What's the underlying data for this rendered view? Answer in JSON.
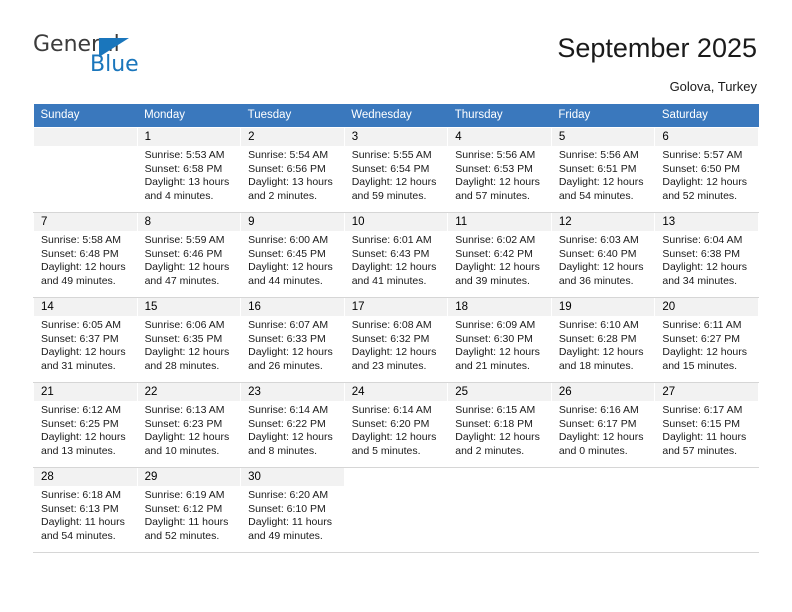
{
  "brand": {
    "name_top": "General",
    "name_bottom": "Blue",
    "triangle_icon": "triangle-icon",
    "accent_color": "#1a76bc"
  },
  "header": {
    "title": "September 2025",
    "subtitle": "Golova, Turkey"
  },
  "calendar": {
    "header_bg": "#3a78bd",
    "daynum_bg": "#f2f2f2",
    "weekdays": [
      "Sunday",
      "Monday",
      "Tuesday",
      "Wednesday",
      "Thursday",
      "Friday",
      "Saturday"
    ],
    "weeks": [
      [
        {
          "day": "",
          "lines": []
        },
        {
          "day": "1",
          "lines": [
            "Sunrise: 5:53 AM",
            "Sunset: 6:58 PM",
            "Daylight: 13 hours",
            "and 4 minutes."
          ]
        },
        {
          "day": "2",
          "lines": [
            "Sunrise: 5:54 AM",
            "Sunset: 6:56 PM",
            "Daylight: 13 hours",
            "and 2 minutes."
          ]
        },
        {
          "day": "3",
          "lines": [
            "Sunrise: 5:55 AM",
            "Sunset: 6:54 PM",
            "Daylight: 12 hours",
            "and 59 minutes."
          ]
        },
        {
          "day": "4",
          "lines": [
            "Sunrise: 5:56 AM",
            "Sunset: 6:53 PM",
            "Daylight: 12 hours",
            "and 57 minutes."
          ]
        },
        {
          "day": "5",
          "lines": [
            "Sunrise: 5:56 AM",
            "Sunset: 6:51 PM",
            "Daylight: 12 hours",
            "and 54 minutes."
          ]
        },
        {
          "day": "6",
          "lines": [
            "Sunrise: 5:57 AM",
            "Sunset: 6:50 PM",
            "Daylight: 12 hours",
            "and 52 minutes."
          ]
        }
      ],
      [
        {
          "day": "7",
          "lines": [
            "Sunrise: 5:58 AM",
            "Sunset: 6:48 PM",
            "Daylight: 12 hours",
            "and 49 minutes."
          ]
        },
        {
          "day": "8",
          "lines": [
            "Sunrise: 5:59 AM",
            "Sunset: 6:46 PM",
            "Daylight: 12 hours",
            "and 47 minutes."
          ]
        },
        {
          "day": "9",
          "lines": [
            "Sunrise: 6:00 AM",
            "Sunset: 6:45 PM",
            "Daylight: 12 hours",
            "and 44 minutes."
          ]
        },
        {
          "day": "10",
          "lines": [
            "Sunrise: 6:01 AM",
            "Sunset: 6:43 PM",
            "Daylight: 12 hours",
            "and 41 minutes."
          ]
        },
        {
          "day": "11",
          "lines": [
            "Sunrise: 6:02 AM",
            "Sunset: 6:42 PM",
            "Daylight: 12 hours",
            "and 39 minutes."
          ]
        },
        {
          "day": "12",
          "lines": [
            "Sunrise: 6:03 AM",
            "Sunset: 6:40 PM",
            "Daylight: 12 hours",
            "and 36 minutes."
          ]
        },
        {
          "day": "13",
          "lines": [
            "Sunrise: 6:04 AM",
            "Sunset: 6:38 PM",
            "Daylight: 12 hours",
            "and 34 minutes."
          ]
        }
      ],
      [
        {
          "day": "14",
          "lines": [
            "Sunrise: 6:05 AM",
            "Sunset: 6:37 PM",
            "Daylight: 12 hours",
            "and 31 minutes."
          ]
        },
        {
          "day": "15",
          "lines": [
            "Sunrise: 6:06 AM",
            "Sunset: 6:35 PM",
            "Daylight: 12 hours",
            "and 28 minutes."
          ]
        },
        {
          "day": "16",
          "lines": [
            "Sunrise: 6:07 AM",
            "Sunset: 6:33 PM",
            "Daylight: 12 hours",
            "and 26 minutes."
          ]
        },
        {
          "day": "17",
          "lines": [
            "Sunrise: 6:08 AM",
            "Sunset: 6:32 PM",
            "Daylight: 12 hours",
            "and 23 minutes."
          ]
        },
        {
          "day": "18",
          "lines": [
            "Sunrise: 6:09 AM",
            "Sunset: 6:30 PM",
            "Daylight: 12 hours",
            "and 21 minutes."
          ]
        },
        {
          "day": "19",
          "lines": [
            "Sunrise: 6:10 AM",
            "Sunset: 6:28 PM",
            "Daylight: 12 hours",
            "and 18 minutes."
          ]
        },
        {
          "day": "20",
          "lines": [
            "Sunrise: 6:11 AM",
            "Sunset: 6:27 PM",
            "Daylight: 12 hours",
            "and 15 minutes."
          ]
        }
      ],
      [
        {
          "day": "21",
          "lines": [
            "Sunrise: 6:12 AM",
            "Sunset: 6:25 PM",
            "Daylight: 12 hours",
            "and 13 minutes."
          ]
        },
        {
          "day": "22",
          "lines": [
            "Sunrise: 6:13 AM",
            "Sunset: 6:23 PM",
            "Daylight: 12 hours",
            "and 10 minutes."
          ]
        },
        {
          "day": "23",
          "lines": [
            "Sunrise: 6:14 AM",
            "Sunset: 6:22 PM",
            "Daylight: 12 hours",
            "and 8 minutes."
          ]
        },
        {
          "day": "24",
          "lines": [
            "Sunrise: 6:14 AM",
            "Sunset: 6:20 PM",
            "Daylight: 12 hours",
            "and 5 minutes."
          ]
        },
        {
          "day": "25",
          "lines": [
            "Sunrise: 6:15 AM",
            "Sunset: 6:18 PM",
            "Daylight: 12 hours",
            "and 2 minutes."
          ]
        },
        {
          "day": "26",
          "lines": [
            "Sunrise: 6:16 AM",
            "Sunset: 6:17 PM",
            "Daylight: 12 hours",
            "and 0 minutes."
          ]
        },
        {
          "day": "27",
          "lines": [
            "Sunrise: 6:17 AM",
            "Sunset: 6:15 PM",
            "Daylight: 11 hours",
            "and 57 minutes."
          ]
        }
      ],
      [
        {
          "day": "28",
          "lines": [
            "Sunrise: 6:18 AM",
            "Sunset: 6:13 PM",
            "Daylight: 11 hours",
            "and 54 minutes."
          ]
        },
        {
          "day": "29",
          "lines": [
            "Sunrise: 6:19 AM",
            "Sunset: 6:12 PM",
            "Daylight: 11 hours",
            "and 52 minutes."
          ]
        },
        {
          "day": "30",
          "lines": [
            "Sunrise: 6:20 AM",
            "Sunset: 6:10 PM",
            "Daylight: 11 hours",
            "and 49 minutes."
          ]
        },
        {
          "day": "",
          "lines": [],
          "blank": true
        },
        {
          "day": "",
          "lines": [],
          "blank": true
        },
        {
          "day": "",
          "lines": [],
          "blank": true
        },
        {
          "day": "",
          "lines": [],
          "blank": true
        }
      ]
    ]
  }
}
